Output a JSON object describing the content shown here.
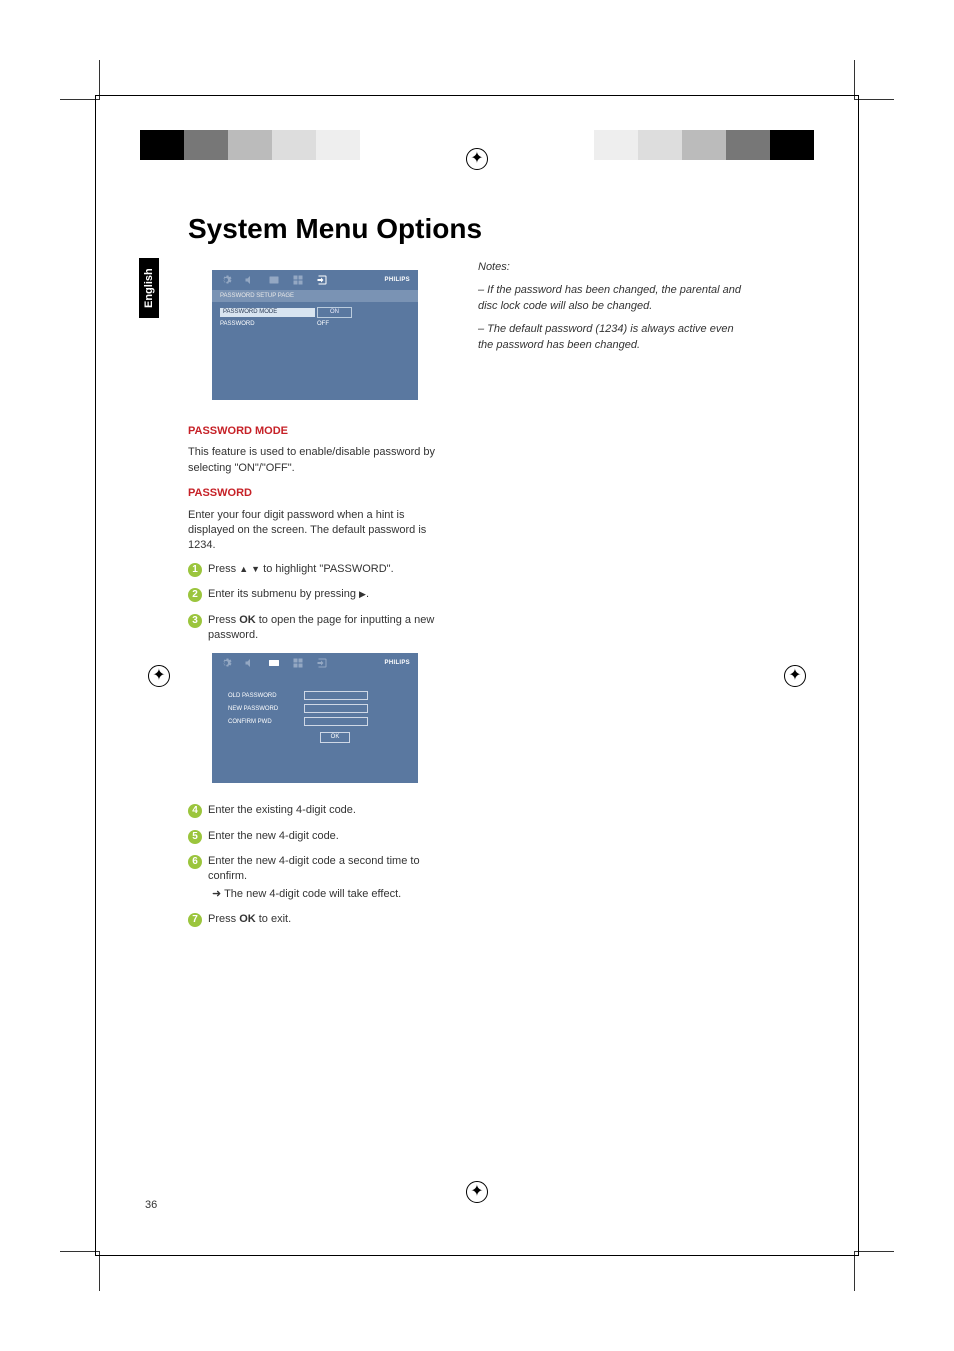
{
  "page": {
    "title": "System Menu Options",
    "language_tab": "English",
    "page_number": "36"
  },
  "osd1": {
    "subtitle": "PASSWORD SETUP PAGE",
    "brand": "PHILIPS",
    "row1_label": "PASSWORD MODE",
    "row1_value": "ON",
    "row2_label": "PASSWORD",
    "row2_value": "OFF"
  },
  "osd2": {
    "brand": "PHILIPS",
    "old_label": "OLD PASSWORD",
    "new_label": "NEW PASSWORD",
    "confirm_label": "CONFIRM PWD",
    "ok": "OK"
  },
  "sections": {
    "pwd_mode_heading": "PASSWORD MODE",
    "pwd_mode_body": "This feature is used to enable/disable password by selecting \"ON\"/\"OFF\".",
    "pwd_heading": "PASSWORD",
    "pwd_body": "Enter your four digit password when a hint is displayed on the screen. The default password is 1234."
  },
  "steps": {
    "s1_pre": "Press ",
    "s1_post": " to highlight \"PASSWORD\".",
    "s2_pre": "Enter its submenu by pressing ",
    "s2_post": ".",
    "s3_pre": "Press ",
    "s3_bold": "OK",
    "s3_post": " to open the page for inputting a new password.",
    "s4": "Enter the existing 4-digit code.",
    "s5": "Enter the new 4-digit code.",
    "s6": "Enter the new 4-digit code a second time to confirm.",
    "s6_sub": "➜ The new 4-digit code will take effect.",
    "s7_pre": "Press ",
    "s7_bold": "OK",
    "s7_post": " to exit."
  },
  "notes": {
    "heading": "Notes:",
    "n1": "–  If the password has been changed, the parental and disc lock code will also be changed.",
    "n2": "–  The default password (1234) is always active even the password has been changed."
  },
  "colors": {
    "bar": [
      "#000",
      "#333",
      "#666",
      "#999",
      "#ccc",
      "#fff",
      "#0ff",
      "#f0f",
      "#ff0",
      "#c62127",
      "#0a0",
      "#00f"
    ]
  }
}
